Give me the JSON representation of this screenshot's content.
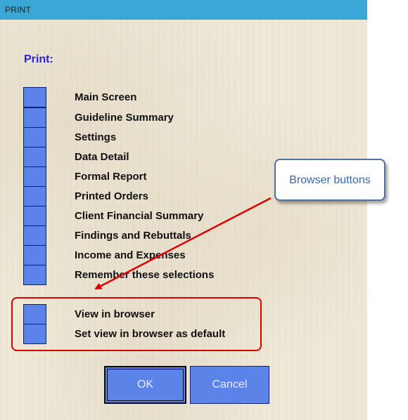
{
  "window": {
    "title": "PRINT"
  },
  "heading": "Print:",
  "print_options": [
    {
      "label": "Main Screen"
    },
    {
      "label": "Guideline Summary"
    },
    {
      "label": "Settings"
    },
    {
      "label": "Data Detail"
    },
    {
      "label": "Formal Report"
    },
    {
      "label": "Printed Orders"
    },
    {
      "label": "Client Financial Summary"
    },
    {
      "label": "Findings and Rebuttals"
    },
    {
      "label": "Income and Expenses"
    },
    {
      "label": "Remember these selections"
    }
  ],
  "browser_options": [
    {
      "label": "View in browser"
    },
    {
      "label": "Set view in browser as default"
    }
  ],
  "annotation": {
    "callout_text": "Browser buttons",
    "color": "#e00000"
  },
  "buttons": {
    "ok_label": "OK",
    "cancel_label": "Cancel"
  },
  "colors": {
    "titlebar": "#3ba7d6",
    "checkbox_fill": "#5c84e8",
    "heading": "#2a25d6"
  }
}
